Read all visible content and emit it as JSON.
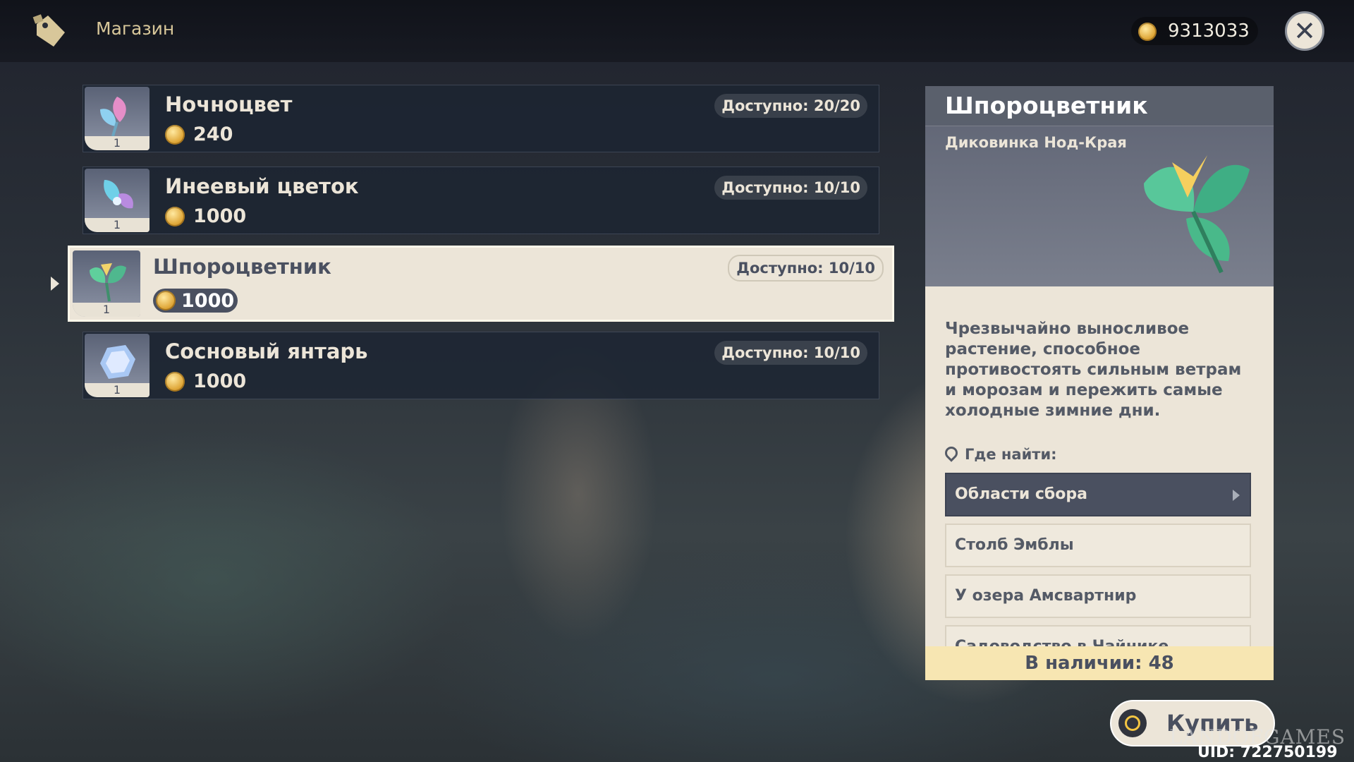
{
  "header": {
    "title": "Магазин",
    "currency": "9313033"
  },
  "items": [
    {
      "name": "Ночноцвет",
      "price": "240",
      "availability": "Доступно: 20/20",
      "qty": "1",
      "icon": "night-flower-icon"
    },
    {
      "name": "Инеевый цветок",
      "price": "1000",
      "availability": "Доступно: 10/10",
      "qty": "1",
      "icon": "frost-flower-icon"
    },
    {
      "name": "Шпороцветник",
      "price": "1000",
      "availability": "Доступно: 10/10",
      "qty": "1",
      "icon": "spur-flower-icon",
      "selected": true
    },
    {
      "name": "Сосновый янтарь",
      "price": "1000",
      "availability": "Доступно: 10/10",
      "qty": "1",
      "icon": "pine-amber-icon"
    }
  ],
  "detail": {
    "title": "Шпороцветник",
    "type": "Диковинка Нод-Края",
    "description": "Чрезвычайно выносливое растение, способное противостоять сильным ветрам и морозам и пережить самые холодные зимние дни.",
    "where_label": "Где найти:",
    "sources": [
      "Области сбора",
      "Столб Эмблы",
      "У озера Амсвартнир",
      "Садоводство в Чайнике"
    ],
    "stock": "В наличии: 48"
  },
  "buy_label": "Купить",
  "watermark": "LANDOFGAMES",
  "uid": "UID: 722750199",
  "colors": {
    "panel_light": "#ece5d8",
    "panel_dark": "#4a5060",
    "stock_bg": "#f7e6b2"
  }
}
